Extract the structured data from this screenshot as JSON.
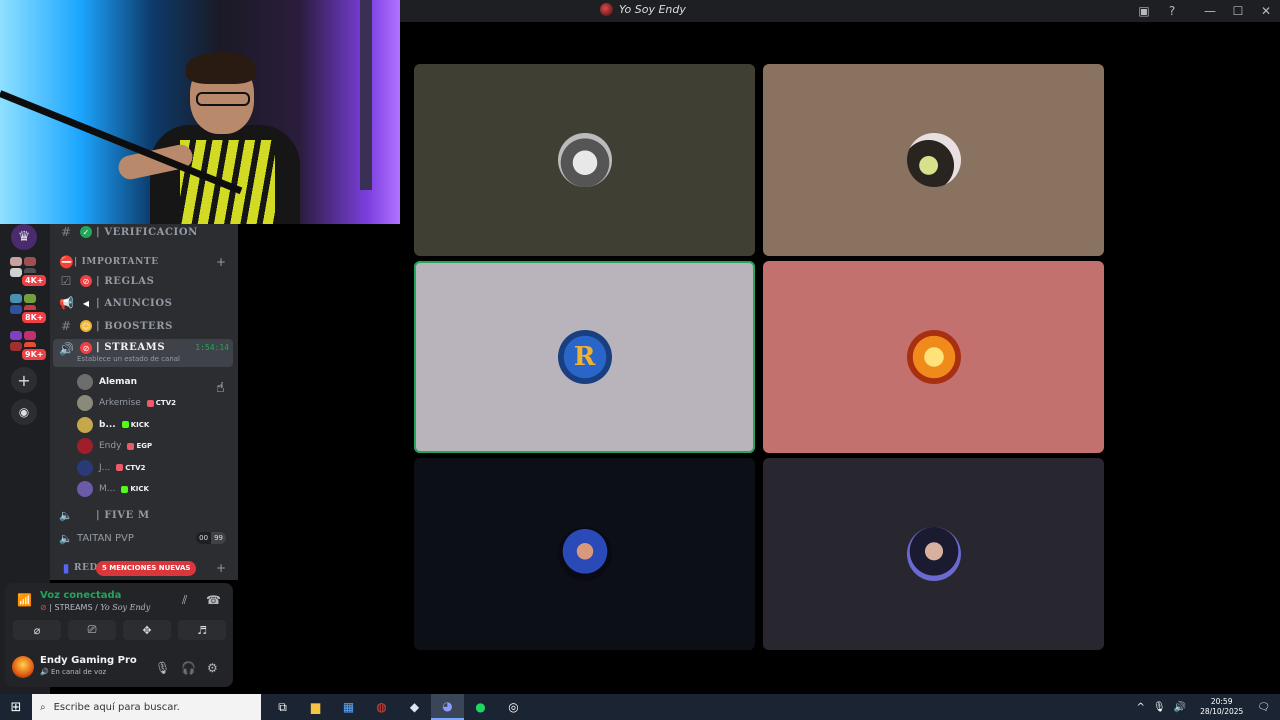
{
  "window": {
    "title": "Yo Soy Endy"
  },
  "titlebar_icons": [
    "inbox-icon",
    "help-icon",
    "minimize-icon",
    "maximize-icon",
    "close-icon"
  ],
  "servers": {
    "badges": [
      "4K+",
      "8K+",
      "9K+"
    ]
  },
  "channels": {
    "verificacion": "| VERIFICACION",
    "category_importante": "| IMPORTANTE",
    "reglas": "| REGLAS",
    "anuncios": "| ANUNCIOS",
    "boosters": "| BOOSTERS",
    "streams": "| STREAMS",
    "streams_timer": "1:54:14",
    "streams_status": "Establece un estado de canal",
    "five_m": "| FIVE M",
    "taitan": "TAITAN PVP",
    "taitan_counter_left": "00",
    "taitan_counter_right": "99",
    "red_partial": "RED",
    "mentions": "5 MENCIONES NUEVAS"
  },
  "voice_users": [
    {
      "name": "Aleman",
      "tag": "",
      "tag_color": ""
    },
    {
      "name": "Arkemise",
      "tag": "CTV2",
      "tag_color": "#f0596b"
    },
    {
      "name": "b...",
      "tag": "KICK",
      "tag_color": "#53fc18"
    },
    {
      "name": "Endy",
      "tag": "EGP",
      "tag_color": "#f0596b"
    },
    {
      "name": "J...",
      "tag": "CTV2",
      "tag_color": "#f0596b"
    },
    {
      "name": "M...",
      "tag": "KICK",
      "tag_color": "#53fc18"
    }
  ],
  "voice_panel": {
    "status": "Voz conectada",
    "channel": "| STREAMS / ",
    "server": "Yo Soy Endy"
  },
  "user": {
    "name": "Endy Gaming Pro",
    "status": "En canal de voz"
  },
  "tiles": [
    {
      "bg": "#3f4033",
      "pfp": "gray-figure"
    },
    {
      "bg": "#8a7260",
      "pfp": "girl-anime"
    },
    {
      "bg": "#b9b4bb",
      "pfp": "R",
      "speaking": true
    },
    {
      "bg": "#c2716f",
      "pfp": "fire-avatar"
    },
    {
      "bg": "#0c0f16",
      "pfp": "blue-avatar"
    },
    {
      "bg": "#28272f",
      "pfp": "woman-avatar"
    }
  ],
  "taskbar": {
    "search_placeholder": "Escribe aquí para buscar.",
    "time": "20:59",
    "date": "28/10/2025"
  },
  "colors": {
    "green": "#23a55a",
    "red": "#f23f43",
    "blurple": "#5865f2"
  }
}
